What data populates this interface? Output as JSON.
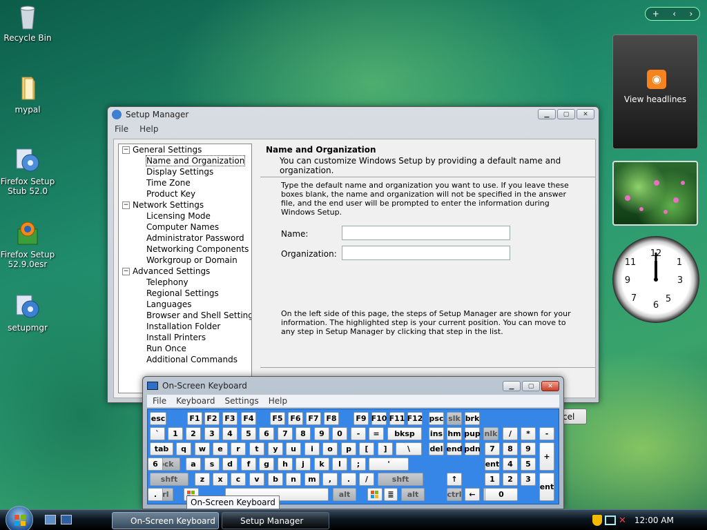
{
  "desktop": {
    "icons": [
      {
        "label": "Recycle Bin",
        "icon": "recycle-bin-icon"
      },
      {
        "label": "mypal",
        "icon": "folder-icon"
      },
      {
        "label": "Firefox Setup Stub 52.0",
        "icon": "installer-icon"
      },
      {
        "label": "Firefox Setup 52.9.0esr",
        "icon": "firefox-installer-icon"
      },
      {
        "label": "setupmgr",
        "icon": "setup-icon"
      }
    ]
  },
  "sidebar_gadgets": {
    "feed_label": "View headlines",
    "accent": "#f5841f"
  },
  "setup_manager": {
    "title": "Setup Manager",
    "menu": [
      "File",
      "Help"
    ],
    "tree": [
      {
        "label": "General Settings",
        "children": [
          "Name and Organization",
          "Display Settings",
          "Time Zone",
          "Product Key"
        ]
      },
      {
        "label": "Network Settings",
        "children": [
          "Licensing Mode",
          "Computer Names",
          "Administrator Password",
          "Networking Components",
          "Workgroup or Domain"
        ]
      },
      {
        "label": "Advanced Settings",
        "children": [
          "Telephony",
          "Regional Settings",
          "Languages",
          "Browser and Shell Settings",
          "Installation Folder",
          "Install Printers",
          "Run Once",
          "Additional Commands"
        ]
      }
    ],
    "selected": "Name and Organization",
    "heading": "Name and Organization",
    "subheading": "You can customize Windows Setup by providing a default name and organization.",
    "instructions": "Type the default name and organization you want to use. If you leave these boxes blank, the name and organization will not be specified in the answer file, and the end user will be prompted to enter the information during Windows Setup.",
    "name_label": "Name:",
    "name_value": "",
    "org_label": "Organization:",
    "org_value": "",
    "footer": "On the left side of this page, the steps of Setup Manager are shown for your information. The highlighted step is your current position. You can move to any step in Setup Manager by clicking that step in the list.",
    "cancel_label": "Cancel"
  },
  "osk": {
    "title": "On-Screen Keyboard",
    "menu": [
      "File",
      "Keyboard",
      "Settings",
      "Help"
    ],
    "rows": [
      [
        "esc",
        "F1",
        "F2",
        "F3",
        "F4",
        "F5",
        "F6",
        "F7",
        "F8",
        "F9",
        "F10",
        "F11",
        "F12",
        "psc",
        "slk",
        "brk"
      ],
      [
        "`",
        "1",
        "2",
        "3",
        "4",
        "5",
        "6",
        "7",
        "8",
        "9",
        "0",
        "-",
        "=",
        "bksp",
        "ins",
        "hm",
        "pup",
        "nlk",
        "/",
        "*",
        "-"
      ],
      [
        "tab",
        "q",
        "w",
        "e",
        "r",
        "t",
        "y",
        "u",
        "i",
        "o",
        "p",
        "[",
        "]",
        "\\",
        "del",
        "end",
        "pdn",
        "7",
        "8",
        "9",
        "+"
      ],
      [
        "lock",
        "a",
        "s",
        "d",
        "f",
        "g",
        "h",
        "j",
        "k",
        "l",
        ";",
        "'",
        "ent",
        "4",
        "5",
        "6"
      ],
      [
        "shft",
        "z",
        "x",
        "c",
        "v",
        "b",
        "n",
        "m",
        ",",
        ".",
        "/",
        "shft",
        "↑",
        "1",
        "2",
        "3",
        "ent"
      ],
      [
        "ctrl",
        "alt",
        "alt",
        "ctrl",
        "←",
        "↓",
        "→",
        "0",
        "."
      ]
    ]
  },
  "tooltip": "On-Screen Keyboard",
  "taskbar": {
    "buttons": [
      "On-Screen Keyboard",
      "Setup Manager"
    ],
    "clock": "12:00 AM"
  }
}
